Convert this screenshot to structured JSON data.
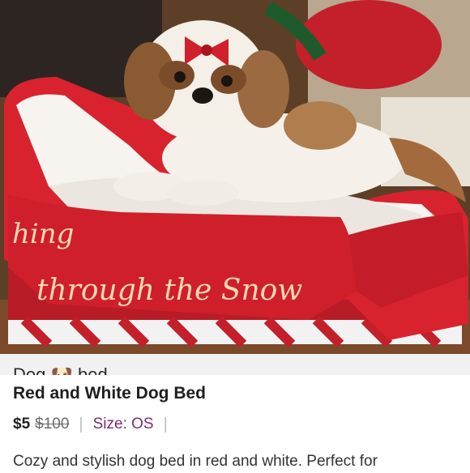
{
  "listing": {
    "photo_alt": "Red and White Dog Bed photo",
    "bed_text_line1": "hing",
    "bed_text_line2": "through the Snow",
    "caption": {
      "pre": "Dog ",
      "emoji": "🐶",
      "post": " bed"
    },
    "title": "Red and White Dog Bed",
    "price": "$5",
    "original_price": "$100",
    "separator": "|",
    "size_label": "Size:",
    "size_value": "OS",
    "description": "Cozy and stylish dog bed in red and white. Perfect for"
  },
  "colors": {
    "bed_red": "#d8232f",
    "size_accent": "#7b2d72"
  }
}
